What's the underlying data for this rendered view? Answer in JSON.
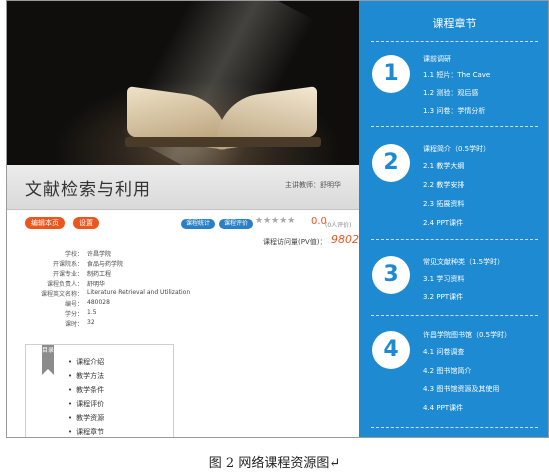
{
  "header": {
    "title": "文献检索与利用",
    "teacher": "主讲教师：舒明华"
  },
  "actions": {
    "edit_label": "编辑本页",
    "settings_label": "设置",
    "stats_label": "课程统计",
    "review_label": "课程评价",
    "stars": "★★★★★",
    "rating": "0.0",
    "raters": "(0人评价)",
    "pv_label": "课程访问量(PV值)：",
    "pv_value": "9802"
  },
  "info": [
    {
      "key": "学校：",
      "value": "许昌学院"
    },
    {
      "key": "开课院系：",
      "value": "食品与药学院"
    },
    {
      "key": "开课专业：",
      "value": "制药工程"
    },
    {
      "key": "课程负责人：",
      "value": "舒明华"
    },
    {
      "key": "课程英文名称：",
      "value": "Literature Retrieval and Utilization"
    },
    {
      "key": "编号：",
      "value": "480028"
    },
    {
      "key": "学分：",
      "value": "1.5"
    },
    {
      "key": "课时：",
      "value": "32"
    }
  ],
  "toc": {
    "tag": "目录",
    "items": [
      "课程介绍",
      "教学方法",
      "教学条件",
      "课程评价",
      "教学资源",
      "课程章节"
    ]
  },
  "panel": {
    "title": "课程章节",
    "sections": [
      {
        "number": "1",
        "title": "课前调研",
        "items": [
          "1.1  短片：The Cave",
          "1.2  测验：观后感",
          "1.3  问卷：学情分析"
        ]
      },
      {
        "number": "2",
        "title": "课程简介（0.5学时）",
        "items": [
          "2.1  教学大纲",
          "2.2  教学安排",
          "2.3  拓展资料",
          "2.4  PPT课件"
        ]
      },
      {
        "number": "3",
        "title": "常见文献种类（1.5学时）",
        "items": [
          "3.1  学习资料",
          "3.2  PPT课件"
        ]
      },
      {
        "number": "4",
        "title": "许昌学院图书馆（0.5学时）",
        "items": [
          "4.1  问卷调查",
          "4.2  图书馆简介",
          "4.3  图书馆资源及其使用",
          "4.4  PPT课件"
        ]
      }
    ]
  },
  "caption": "图 2    网络课程资源图↵"
}
